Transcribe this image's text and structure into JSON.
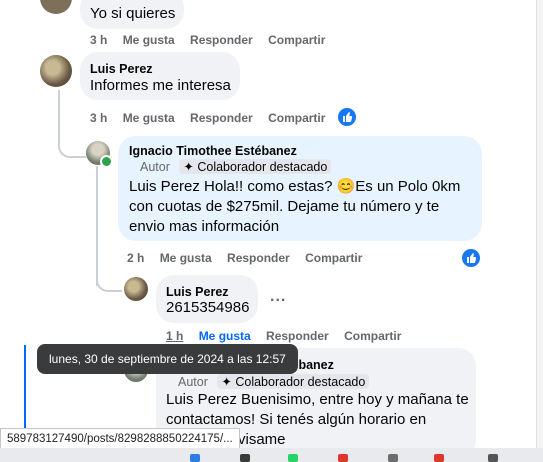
{
  "comments": [
    {
      "text": "Yo si quieres",
      "actions": [
        "3 h",
        "Me gusta",
        "Responder",
        "Compartir"
      ]
    },
    {
      "name": "Luis Perez",
      "text": "Informes me interesa",
      "actions": [
        "3 h",
        "Me gusta",
        "Responder",
        "Compartir"
      ],
      "reaction_icon": "like-icon"
    },
    {
      "name": "Ignacio Timothee Estébanez",
      "role": "Autor",
      "badge": "Colaborador destacado",
      "text_lines": [
        "Luis Perez Hola!! como estas? 😊Es un Polo 0km",
        "con cuotas de $275mil. Dejame tu número y te",
        "envio mas información"
      ],
      "actions": [
        "2 h",
        "Me gusta",
        "Responder",
        "Compartir"
      ],
      "reaction_icon": "like-icon"
    },
    {
      "name": "Luis Perez",
      "text": "2615354986",
      "more": "...",
      "actions": [
        "1 h",
        "Me gusta",
        "Responder",
        "Compartir"
      ]
    },
    {
      "name": "Ignacio Timothee Estébanez",
      "role": "Autor",
      "badge": "Colaborador destacado",
      "text_lines": [
        "Luis Perez Buenisimo, entre hoy y mañana te",
        "contactamos! Si tenés algún horario en",
        "visame"
      ]
    }
  ],
  "tooltip": "lunes, 30 de septiembre de 2024 a las 12:57",
  "status_url": "589783127490/posts/8298288850224175/...",
  "colors": {
    "link_blue": "#0866ff",
    "bubble_gray": "#f0f2f5",
    "bubble_blue": "#e7f3ff"
  }
}
